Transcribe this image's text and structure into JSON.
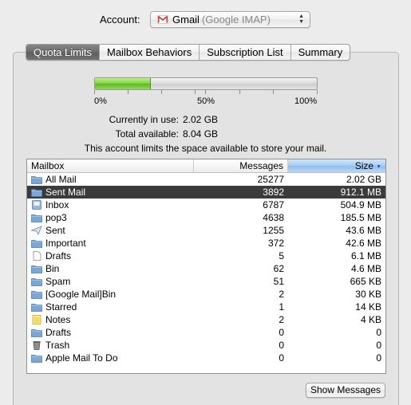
{
  "account": {
    "label": "Account:",
    "name": "Gmail",
    "detail": "(Google IMAP)",
    "icon": "gmail-icon"
  },
  "tabs": [
    {
      "label": "Quota Limits",
      "active": true
    },
    {
      "label": "Mailbox Behaviors",
      "active": false
    },
    {
      "label": "Subscription List",
      "active": false
    },
    {
      "label": "Summary",
      "active": false
    }
  ],
  "quota": {
    "used_fraction": 0.25,
    "fill_color": "#7ed03f",
    "scale": [
      "0%",
      "50%",
      "100%"
    ],
    "in_use_label": "Currently in use:",
    "in_use_value": "2.02 GB",
    "available_label": "Total available:",
    "available_value": "8.04 GB",
    "note": "This account limits the space available to store your mail."
  },
  "table": {
    "columns": {
      "mailbox": "Mailbox",
      "messages": "Messages",
      "size": "Size"
    },
    "sort_column": "size",
    "rows": [
      {
        "icon": "folder-icon",
        "mailbox": "All Mail",
        "messages": "25277",
        "size": "2.02 GB",
        "selected": false
      },
      {
        "icon": "folder-icon",
        "mailbox": "Sent Mail",
        "messages": "3892",
        "size": "912.1 MB",
        "selected": true
      },
      {
        "icon": "inbox-icon",
        "mailbox": "Inbox",
        "messages": "6787",
        "size": "504.9 MB",
        "selected": false
      },
      {
        "icon": "folder-icon",
        "mailbox": "pop3",
        "messages": "4638",
        "size": "185.5 MB",
        "selected": false
      },
      {
        "icon": "sent-icon",
        "mailbox": "Sent",
        "messages": "1255",
        "size": "43.6 MB",
        "selected": false
      },
      {
        "icon": "folder-icon",
        "mailbox": "Important",
        "messages": "372",
        "size": "42.6 MB",
        "selected": false
      },
      {
        "icon": "drafts-icon",
        "mailbox": "Drafts",
        "messages": "5",
        "size": "6.1 MB",
        "selected": false
      },
      {
        "icon": "folder-icon",
        "mailbox": "Bin",
        "messages": "62",
        "size": "4.6 MB",
        "selected": false
      },
      {
        "icon": "folder-icon",
        "mailbox": "Spam",
        "messages": "51",
        "size": "665 KB",
        "selected": false
      },
      {
        "icon": "folder-icon",
        "mailbox": "[Google Mail]Bin",
        "messages": "2",
        "size": "30 KB",
        "selected": false
      },
      {
        "icon": "folder-icon",
        "mailbox": "Starred",
        "messages": "1",
        "size": "14 KB",
        "selected": false
      },
      {
        "icon": "notes-icon",
        "mailbox": "Notes",
        "messages": "2",
        "size": "4 KB",
        "selected": false
      },
      {
        "icon": "folder-icon",
        "mailbox": "Drafts",
        "messages": "0",
        "size": "0",
        "selected": false
      },
      {
        "icon": "trash-icon",
        "mailbox": "Trash",
        "messages": "0",
        "size": "0",
        "selected": false
      },
      {
        "icon": "folder-icon",
        "mailbox": "Apple Mail To Do",
        "messages": "0",
        "size": "0",
        "selected": false
      }
    ]
  },
  "buttons": {
    "show_messages": "Show Messages"
  },
  "colors": {
    "selected_row": "#3b3b3b",
    "sort_header": "#a6cbf2",
    "folder": "#7aa7d6"
  }
}
